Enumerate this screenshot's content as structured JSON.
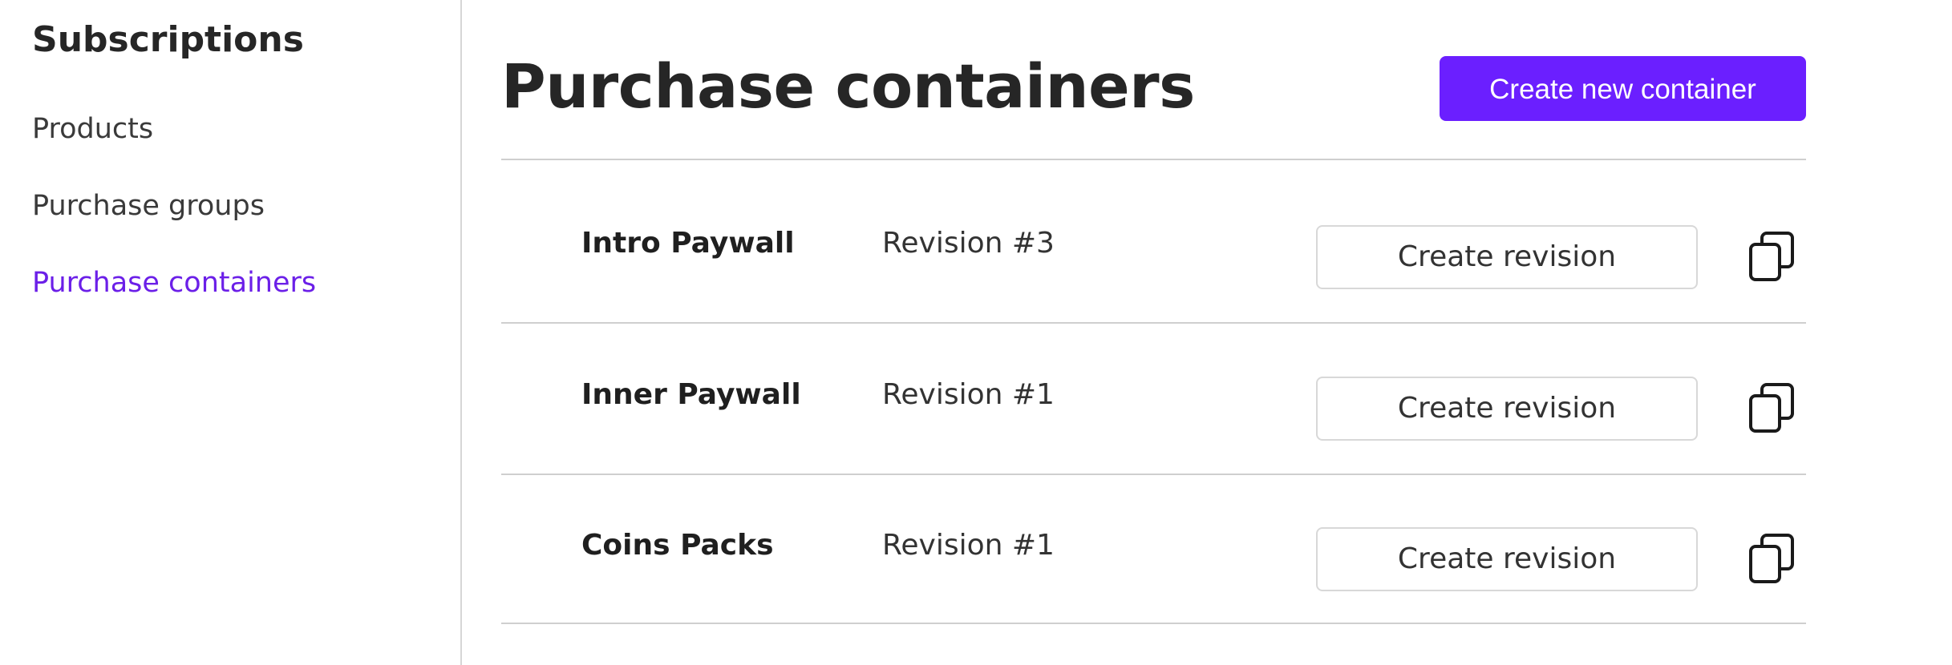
{
  "sidebar": {
    "title": "Subscriptions",
    "items": [
      {
        "label": "Products",
        "active": false
      },
      {
        "label": "Purchase groups",
        "active": false
      },
      {
        "label": "Purchase containers",
        "active": true
      }
    ]
  },
  "main": {
    "title": "Purchase containers",
    "create_button_label": "Create new container",
    "rows": [
      {
        "name": "Intro Paywall",
        "revision": "Revision #3",
        "action_label": "Create revision",
        "copy_icon": "copy-icon"
      },
      {
        "name": "Inner Paywall",
        "revision": "Revision #1",
        "action_label": "Create revision",
        "copy_icon": "copy-icon"
      },
      {
        "name": "Coins Packs",
        "revision": "Revision #1",
        "action_label": "Create revision",
        "copy_icon": "copy-icon"
      }
    ]
  },
  "colors": {
    "accent": "#6b1fff",
    "active_nav": "#6b1fe8",
    "text": "#262626",
    "divider": "#cfcfcf"
  }
}
